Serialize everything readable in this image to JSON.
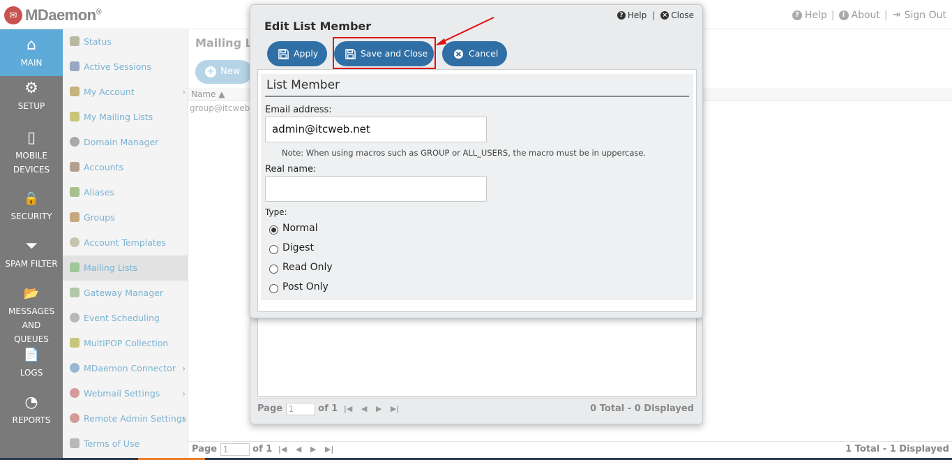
{
  "app": {
    "logo_text": "MDaemon",
    "logo_mark": "✉",
    "registered": "®"
  },
  "topnav": {
    "help": "Help",
    "about": "About",
    "signout": "Sign Out"
  },
  "sidebar": {
    "items": [
      {
        "label": "MAIN",
        "icon": "home-icon",
        "glyph": "⌂"
      },
      {
        "label": "SETUP",
        "icon": "gears-icon",
        "glyph": "⚙"
      },
      {
        "label": "MOBILE DEVICES",
        "icon": "mobile-icon",
        "glyph": "▯"
      },
      {
        "label": "SECURITY",
        "icon": "lock-icon",
        "glyph": "🔒"
      },
      {
        "label": "SPAM FILTER",
        "icon": "filter-icon",
        "glyph": "⏷"
      },
      {
        "label": "MESSAGES AND QUEUES",
        "icon": "folder-icon",
        "glyph": "📂"
      },
      {
        "label": "LOGS",
        "icon": "document-icon",
        "glyph": "📄"
      },
      {
        "label": "REPORTS",
        "icon": "dashboard-icon",
        "glyph": "◔"
      }
    ]
  },
  "subnav": {
    "items": [
      {
        "label": "Status",
        "icon": "status-icon",
        "color": "#b9b9a0"
      },
      {
        "label": "Active Sessions",
        "icon": "sessions-icon",
        "color": "#9aa7c4"
      },
      {
        "label": "My Account",
        "icon": "account-icon",
        "color": "#c7b37c"
      },
      {
        "label": "My Mailing Lists",
        "icon": "mailing-lists-icon",
        "color": "#c9c57a"
      },
      {
        "label": "Domain Manager",
        "icon": "domain-icon",
        "color": "#a9a9a9"
      },
      {
        "label": "Accounts",
        "icon": "accounts-icon",
        "color": "#b3a190"
      },
      {
        "label": "Aliases",
        "icon": "aliases-icon",
        "color": "#a9c18e"
      },
      {
        "label": "Groups",
        "icon": "groups-icon",
        "color": "#c8a97d"
      },
      {
        "label": "Account Templates",
        "icon": "templates-icon",
        "color": "#c6c6b0"
      },
      {
        "label": "Mailing Lists",
        "icon": "mailing-list-icon",
        "color": "#9fc79a"
      },
      {
        "label": "Gateway Manager",
        "icon": "gateway-icon",
        "color": "#b1c9a8"
      },
      {
        "label": "Event Scheduling",
        "icon": "clock-icon",
        "color": "#b8b8b8"
      },
      {
        "label": "MultiPOP Collection",
        "icon": "multipop-icon",
        "color": "#c8c57c"
      },
      {
        "label": "MDaemon Connector",
        "icon": "connector-icon",
        "color": "#9ab8d4"
      },
      {
        "label": "Webmail Settings",
        "icon": "webmail-icon",
        "color": "#d49b9b"
      },
      {
        "label": "Remote Admin Settings",
        "icon": "remote-admin-icon",
        "color": "#d49b9b"
      },
      {
        "label": "Terms of Use",
        "icon": "terms-icon",
        "color": "#b8b8b8"
      }
    ]
  },
  "main": {
    "title": "Mailing Lis",
    "new_label": "New",
    "col_name": "Name ▲",
    "row1": "group@itcweb.",
    "pager_page": "Page",
    "pager_value": "1",
    "pager_of": "of 1",
    "pager_total": "1 Total - 1 Displayed"
  },
  "dialog": {
    "title": "Edit List Member",
    "help": "Help",
    "close": "Close",
    "apply": "Apply",
    "save_close": "Save and Close",
    "cancel": "Cancel",
    "section": "List Member",
    "email_label": "Email address:",
    "email_value": "admin@itcweb.net",
    "note": "Note: When using macros such as GROUP or ALL_USERS, the macro must be in uppercase.",
    "realname_label": "Real name:",
    "realname_value": "",
    "type_label": "Type:",
    "types": [
      "Normal",
      "Digest",
      "Read Only",
      "Post Only"
    ],
    "selected_type": "Normal",
    "pager_page": "Page",
    "pager_value": "1",
    "pager_of": "of 1",
    "pager_total": "0 Total - 0 Displayed"
  },
  "colors": {
    "accent": "#2f6fa5",
    "sidebar": "#7a7a7a",
    "sidebar_active": "#5eaad8",
    "highlight": "#e01010"
  }
}
